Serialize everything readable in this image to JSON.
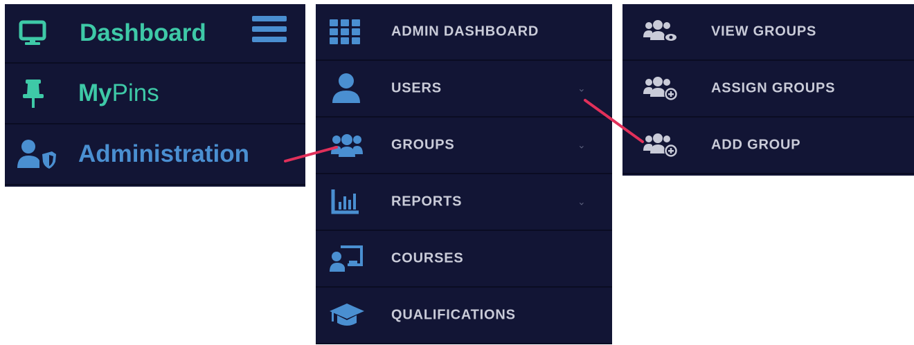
{
  "colors": {
    "panel_bg": "#121535",
    "teal": "#3ec9a7",
    "blue": "#4a8fd1",
    "menu_text": "#c9cbd8",
    "arrow": "#e1305a"
  },
  "main_nav": {
    "dashboard": {
      "label": "Dashboard",
      "icon": "monitor-icon"
    },
    "hamburger_icon": "hamburger-menu-icon",
    "mypins": {
      "label_bold": "My",
      "label_rest": "Pins",
      "icon": "pushpin-icon"
    },
    "administration": {
      "label": "Administration",
      "icon": "user-shield-icon"
    }
  },
  "admin_menu": {
    "items": [
      {
        "label": "ADMIN DASHBOARD",
        "icon": "grid-icon"
      },
      {
        "label": "USERS",
        "icon": "user-icon",
        "chevron": "⌄"
      },
      {
        "label": "GROUPS",
        "icon": "users-group-icon",
        "chevron": "⌄"
      },
      {
        "label": "REPORTS",
        "icon": "bar-chart-icon",
        "chevron": "⌄"
      },
      {
        "label": "COURSES",
        "icon": "chalkboard-teacher-icon"
      },
      {
        "label": "QUALIFICATIONS",
        "icon": "graduation-cap-icon"
      }
    ]
  },
  "groups_submenu": {
    "items": [
      {
        "label": "VIEW GROUPS",
        "icon": "users-view-icon"
      },
      {
        "label": "ASSIGN GROUPS",
        "icon": "users-assign-icon"
      },
      {
        "label": "ADD GROUP",
        "icon": "users-add-icon"
      }
    ]
  }
}
